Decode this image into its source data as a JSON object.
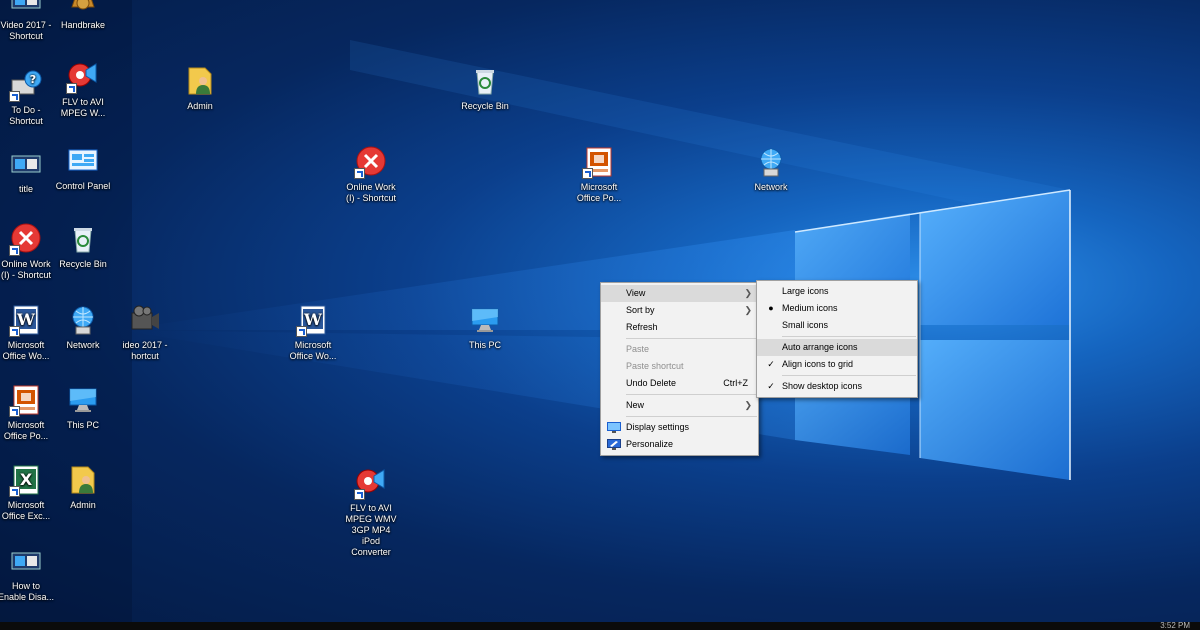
{
  "desktop": {
    "icons": [
      {
        "label": "Video 2017 -\nShortcut",
        "icon": "video-icon"
      },
      {
        "label": "Handbrake",
        "icon": "handbrake-icon"
      },
      {
        "label": "To Do -\nShortcut",
        "icon": "todo-icon"
      },
      {
        "label": "FLV to AVI\nMPEG W...",
        "icon": "flv-converter-icon"
      },
      {
        "label": "Admin",
        "icon": "user-folder-icon"
      },
      {
        "label": "Recycle Bin",
        "icon": "recycle-bin-icon"
      },
      {
        "label": "title",
        "icon": "video-icon"
      },
      {
        "label": "Control Panel",
        "icon": "control-panel-icon"
      },
      {
        "label": "Online Work\n(I) - Shortcut",
        "icon": "error-icon"
      },
      {
        "label": "Microsoft\nOffice Po...",
        "icon": "powerpoint-icon"
      },
      {
        "label": "Network",
        "icon": "network-icon"
      },
      {
        "label": "Online Work\n(I) - Shortcut",
        "icon": "error-icon"
      },
      {
        "label": "Recycle Bin",
        "icon": "recycle-bin-icon"
      },
      {
        "label": "Microsoft\nOffice Wo...",
        "icon": "word-icon"
      },
      {
        "label": "Network",
        "icon": "network-icon"
      },
      {
        "label": "ideo 2017 -\nhortcut",
        "icon": "video-camera-icon"
      },
      {
        "label": "Microsoft\nOffice Wo...",
        "icon": "word-icon"
      },
      {
        "label": "This PC",
        "icon": "this-pc-icon"
      },
      {
        "label": "Microsoft\nOffice Po...",
        "icon": "powerpoint-icon"
      },
      {
        "label": "This PC",
        "icon": "this-pc-icon"
      },
      {
        "label": "Microsoft\nOffice Exc...",
        "icon": "excel-icon"
      },
      {
        "label": "Admin",
        "icon": "user-folder-icon"
      },
      {
        "label": "FLV to AVI\nMPEG WMV\n3GP MP4\niPod\nConverter",
        "icon": "flv-converter-icon"
      },
      {
        "label": "How to\nEnable Disa...",
        "icon": "video-icon"
      }
    ]
  },
  "context_menu": {
    "view": "View",
    "sort_by": "Sort by",
    "refresh": "Refresh",
    "paste": "Paste",
    "paste_shortcut": "Paste shortcut",
    "undo_delete": "Undo Delete",
    "undo_shortcut": "Ctrl+Z",
    "new": "New",
    "display_settings": "Display settings",
    "personalize": "Personalize"
  },
  "view_submenu": {
    "large_icons": "Large icons",
    "medium_icons": "Medium icons",
    "small_icons": "Small icons",
    "auto_arrange": "Auto arrange icons",
    "align_to_grid": "Align icons to grid",
    "show_desktop_icons": "Show desktop icons",
    "selected_size": "Medium icons",
    "checked": [
      "Align icons to grid",
      "Show desktop icons"
    ]
  },
  "taskbar": {
    "clock": "3:52 PM"
  },
  "colors": {
    "menu_bg": "#f2f2f2",
    "menu_highlight": "#dadada",
    "wallpaper_accent": "#2c8de8"
  }
}
